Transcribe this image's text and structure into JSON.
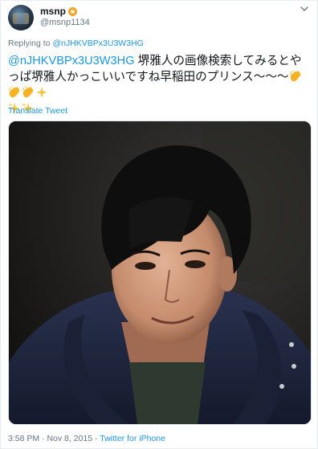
{
  "tweet": {
    "display_name": "msnp",
    "handle": "@msnp1134",
    "replying_prefix": "Replying to",
    "replying_to": "@nJHKVBPx3U3W3HG",
    "mention": "@nJHKVBPx3U3W3HG",
    "text": " 堺雅人の画像検索してみるとやっぱ堺雅人かっこいいですね早稲田のプリンス〜〜〜",
    "translate_label": "Translate Tweet",
    "time": "3:58 PM",
    "date": "Nov 8, 2015",
    "separator": "·",
    "source": "Twitter for iPhone"
  },
  "icons": {
    "name_badge": "orange-face-emoji",
    "menu": "chevron-down-icon",
    "clap": "clapping-hands-emoji",
    "sparkles": "sparkles-emoji"
  },
  "colors": {
    "link": "#1b95e0",
    "secondary_text": "#657786",
    "primary_text": "#14171a",
    "clap": "#f5b323",
    "sparkle": "#f6c236"
  }
}
